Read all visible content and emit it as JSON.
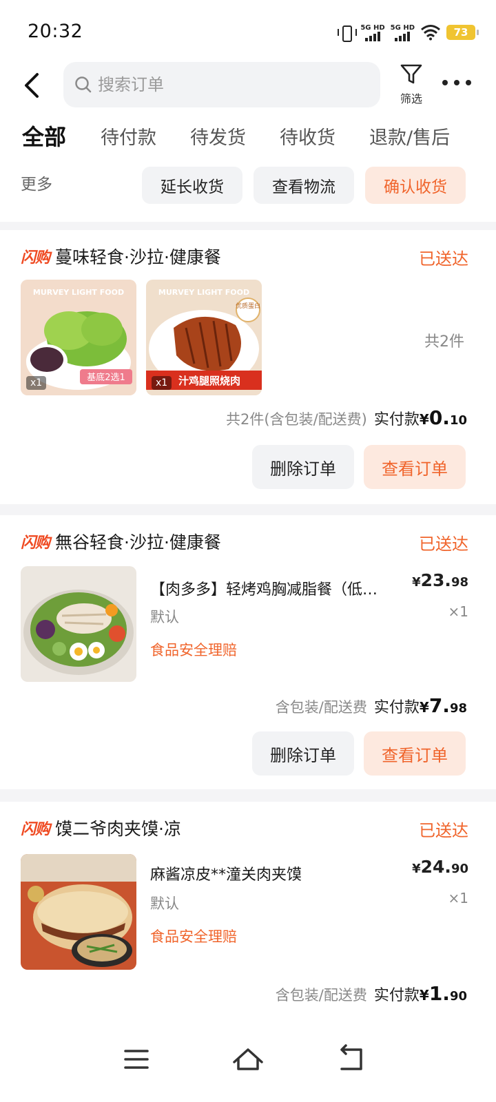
{
  "status_bar": {
    "time": "20:32",
    "signal1_label": "5G HD",
    "signal2_label": "5G HD",
    "battery": "73",
    "icons": [
      "vibrate-icon",
      "signal-icon",
      "wifi-icon",
      "battery-icon"
    ]
  },
  "header": {
    "search_placeholder": "搜索订单",
    "filter_label": "筛选"
  },
  "tabs": [
    {
      "label": "全部",
      "active": true
    },
    {
      "label": "待付款",
      "active": false
    },
    {
      "label": "待发货",
      "active": false
    },
    {
      "label": "待收货",
      "active": false
    },
    {
      "label": "退款/售后",
      "active": false
    }
  ],
  "quick_actions": {
    "more_label": "更多",
    "items": [
      "延长收货",
      "查看物流",
      "确认收货"
    ]
  },
  "orders": [
    {
      "brand": "闪购",
      "shop": "蔓味轻食·沙拉·健康餐",
      "status": "已送达",
      "images": [
        {
          "caption_top": "MURVEY LIGHT FOOD",
          "caption_bottom": "基底2选1",
          "qty": "x1"
        },
        {
          "caption_top": "MURVEY LIGHT FOOD",
          "caption_bottom": "汁鸡腿照烧肉",
          "corner_tag": "优质蛋白",
          "qty": "x1"
        }
      ],
      "count_right": "共2件",
      "summary_note": "共2件(含包装/配送费)",
      "paid_label": "实付款",
      "paid_yen": "¥",
      "paid_int": "0.",
      "paid_dec": "10",
      "btn_delete": "删除订单",
      "btn_view": "查看订单"
    },
    {
      "brand": "闪购",
      "shop": "無谷轻食·沙拉·健康餐",
      "status": "已送达",
      "item_title": "【肉多多】轻烤鸡胸减脂餐（低…",
      "item_spec": "默认",
      "item_tag": "食品安全理赔",
      "price_yen": "¥",
      "price_int": "23.",
      "price_dec": "98",
      "qty": "×1",
      "summary_note": "含包装/配送费",
      "paid_label": "实付款",
      "paid_yen": "¥",
      "paid_int": "7.",
      "paid_dec": "98",
      "btn_delete": "删除订单",
      "btn_view": "查看订单"
    },
    {
      "brand": "闪购",
      "shop": "馍二爷肉夹馍·凉",
      "status": "已送达",
      "item_title": "麻酱凉皮**潼关肉夹馍",
      "item_spec": "默认",
      "item_tag": "食品安全理赔",
      "price_yen": "¥",
      "price_int": "24.",
      "price_dec": "90",
      "qty": "×1",
      "summary_note": "含包装/配送费",
      "paid_label": "实付款",
      "paid_yen": "¥",
      "paid_int": "1.",
      "paid_dec": "90"
    }
  ],
  "colors": {
    "accent": "#f0642b",
    "brand_red": "#ef4a22",
    "battery": "#f0c431",
    "button_bg": "#f2f3f5",
    "primary_button_bg": "#fde9df"
  },
  "nav_icons": [
    "menu-icon",
    "home-icon",
    "back-nav-icon"
  ]
}
